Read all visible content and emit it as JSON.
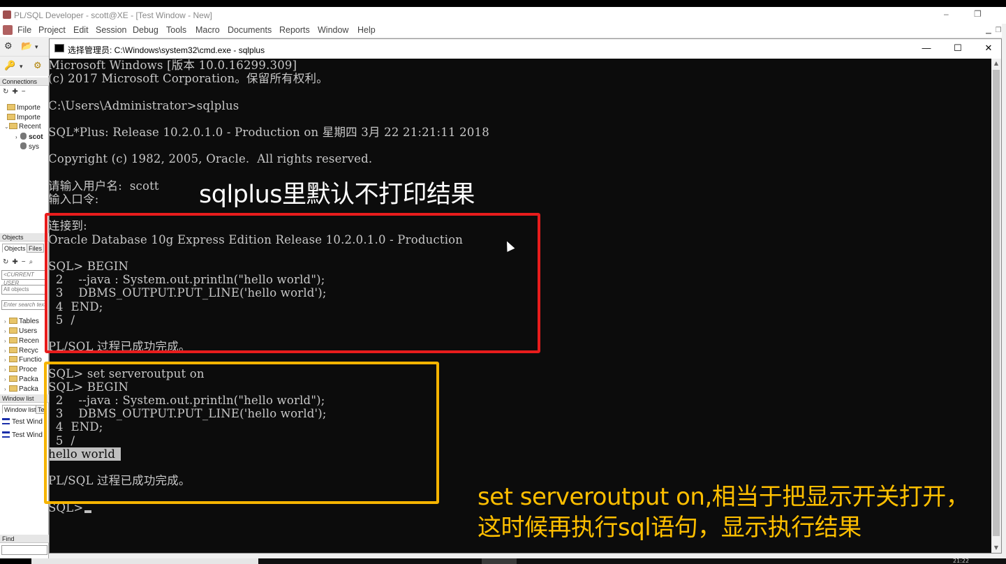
{
  "app": {
    "title": "PL/SQL Developer - scott@XE - [Test Window - New]",
    "menu": [
      "File",
      "Project",
      "Edit",
      "Session",
      "Debug",
      "Tools",
      "Macro",
      "Documents",
      "Reports",
      "Window",
      "Help"
    ]
  },
  "side": {
    "connections_header": "Connections",
    "connections": [
      {
        "label": "Importe",
        "type": "folder"
      },
      {
        "label": "Importe",
        "type": "folder"
      },
      {
        "label": "Recent",
        "type": "folder"
      },
      {
        "label": "scot",
        "type": "db"
      },
      {
        "label": "sys",
        "type": "db"
      }
    ],
    "objects_header": "Objects",
    "tabs": [
      "Objects",
      "Files"
    ],
    "current_user": "<CURRENT USER",
    "all_objects": "All objects",
    "search_placeholder": "Enter search text",
    "object_folders": [
      "Tables",
      "Users",
      "Recen",
      "Recyc",
      "Functio",
      "Proce",
      "Packa",
      "Packa"
    ],
    "window_list_header": "Window list",
    "window_tabs": [
      "Window list",
      "Te"
    ],
    "windows": [
      "Test Wind",
      "Test Wind"
    ],
    "find_header": "Find"
  },
  "cmd": {
    "title": "选择管理员: C:\\Windows\\system32\\cmd.exe - sqlplus",
    "lines": [
      "Microsoft Windows [版本 10.0.16299.309]",
      "(c) 2017 Microsoft Corporation。保留所有权利。",
      "",
      "C:\\Users\\Administrator>sqlplus",
      "",
      "SQL*Plus: Release 10.2.0.1.0 - Production on 星期四 3月 22 21:21:11 2018",
      "",
      "Copyright (c) 1982, 2005, Oracle.  All rights reserved.",
      "",
      "请输入用户名:  scott",
      "输入口令:",
      "",
      "连接到:",
      "Oracle Database 10g Express Edition Release 10.2.0.1.0 - Production",
      "",
      "SQL> BEGIN",
      "  2    --java : System.out.println(\"hello world\");",
      "  3    DBMS_OUTPUT.PUT_LINE('hello world');",
      "  4  END;",
      "  5  /",
      "",
      "PL/SQL 过程已成功完成。",
      "",
      "SQL> set serveroutput on",
      "SQL> BEGIN",
      "  2    --java : System.out.println(\"hello world\");",
      "  3    DBMS_OUTPUT.PUT_LINE('hello world');",
      "  4  END;",
      "  5  /",
      "hello world",
      "",
      "PL/SQL 过程已成功完成。",
      "",
      "SQL> "
    ],
    "highlighted_line": 29
  },
  "annotations": {
    "top": "sqlplus里默认不打印结果",
    "bottom_line1": "set serveroutput on,相当于把显示开关打开，",
    "bottom_line2": "这时候再执行sql语句，显示执行结果",
    "colors": {
      "red_box": "#e81c1c",
      "orange_box": "#f6b400",
      "top_text": "#ffffff",
      "bottom_text": "#ffbf00"
    }
  },
  "taskbar": {
    "clock": "21:22"
  }
}
